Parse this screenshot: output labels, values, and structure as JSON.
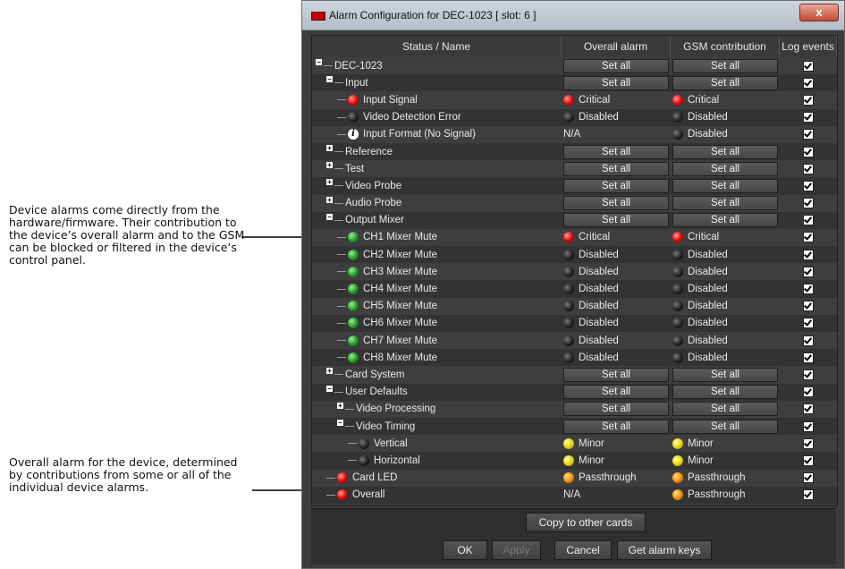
{
  "annotations": {
    "device_alarms": "Device alarms come directly from the hardware/firmware. Their contribution to the device’s overall alarm and to the GSM can be blocked or filtered in the device’s control panel.",
    "overall_alarm": "Overall alarm for the device, determined by contributions from some or all of the individual device alarms."
  },
  "window": {
    "title": "Alarm Configuration for DEC-1023 [ slot: 6 ]",
    "close_label": "x"
  },
  "table": {
    "headers": [
      "Status / Name",
      "Overall alarm",
      "GSM contribution",
      "Log events"
    ],
    "set_all_label": "Set all",
    "rows": [
      {
        "name": "DEC-1023",
        "expander": "−",
        "overall": "Set all",
        "gsm": "Set all"
      },
      {
        "name": "Input",
        "expander": "−",
        "overall": "Set all",
        "gsm": "Set all"
      },
      {
        "name": "Input Signal",
        "led": "red",
        "overall_led": "red",
        "overall": "Critical",
        "gsm_led": "red",
        "gsm": "Critical"
      },
      {
        "name": "Video Detection Error",
        "led": "black",
        "overall_led": "black",
        "overall": "Disabled",
        "gsm_led": "black",
        "gsm": "Disabled"
      },
      {
        "name": "Input Format (No Signal)",
        "led": "info",
        "overall": "N/A",
        "gsm_led": "black",
        "gsm": "Disabled"
      },
      {
        "name": "Reference",
        "expander": "+",
        "overall": "Set all",
        "gsm": "Set all"
      },
      {
        "name": "Test",
        "expander": "+",
        "overall": "Set all",
        "gsm": "Set all"
      },
      {
        "name": "Video Probe",
        "expander": "+",
        "overall": "Set all",
        "gsm": "Set all"
      },
      {
        "name": "Audio Probe",
        "expander": "+",
        "overall": "Set all",
        "gsm": "Set all"
      },
      {
        "name": "Output Mixer",
        "expander": "−",
        "overall": "Set all",
        "gsm": "Set all"
      },
      {
        "name": "CH1 Mixer Mute",
        "led": "green",
        "overall_led": "red",
        "overall": "Critical",
        "gsm_led": "red",
        "gsm": "Critical"
      },
      {
        "name": "CH2 Mixer Mute",
        "led": "green",
        "overall_led": "black",
        "overall": "Disabled",
        "gsm_led": "black",
        "gsm": "Disabled"
      },
      {
        "name": "CH3 Mixer Mute",
        "led": "green",
        "overall_led": "black",
        "overall": "Disabled",
        "gsm_led": "black",
        "gsm": "Disabled"
      },
      {
        "name": "CH4 Mixer Mute",
        "led": "green",
        "overall_led": "black",
        "overall": "Disabled",
        "gsm_led": "black",
        "gsm": "Disabled"
      },
      {
        "name": "CH5 Mixer Mute",
        "led": "green",
        "overall_led": "black",
        "overall": "Disabled",
        "gsm_led": "black",
        "gsm": "Disabled"
      },
      {
        "name": "CH6 Mixer Mute",
        "led": "green",
        "overall_led": "black",
        "overall": "Disabled",
        "gsm_led": "black",
        "gsm": "Disabled"
      },
      {
        "name": "CH7 Mixer Mute",
        "led": "green",
        "overall_led": "black",
        "overall": "Disabled",
        "gsm_led": "black",
        "gsm": "Disabled"
      },
      {
        "name": "CH8 Mixer Mute",
        "led": "green",
        "overall_led": "black",
        "overall": "Disabled",
        "gsm_led": "black",
        "gsm": "Disabled"
      },
      {
        "name": "Card System",
        "expander": "+",
        "overall": "Set all",
        "gsm": "Set all"
      },
      {
        "name": "User Defaults",
        "expander": "−",
        "overall": "Set all",
        "gsm": "Set all"
      },
      {
        "name": "Video Processing",
        "expander": "+",
        "overall": "Set all",
        "gsm": "Set all"
      },
      {
        "name": "Video Timing",
        "expander": "−",
        "overall": "Set all",
        "gsm": "Set all"
      },
      {
        "name": "Vertical",
        "led": "black",
        "overall_led": "yellow",
        "overall": "Minor",
        "gsm_led": "yellow",
        "gsm": "Minor"
      },
      {
        "name": "Horizontal",
        "led": "black",
        "overall_led": "yellow",
        "overall": "Minor",
        "gsm_led": "yellow",
        "gsm": "Minor"
      },
      {
        "name": "Card LED",
        "led": "red",
        "overall_led": "orange",
        "overall": "Passthrough",
        "gsm_led": "orange",
        "gsm": "Passthrough"
      },
      {
        "name": "Overall",
        "led": "red",
        "overall": "N/A",
        "gsm_led": "orange",
        "gsm": "Passthrough"
      }
    ]
  },
  "footer": {
    "copy_label": "Copy to other cards",
    "ok_label": "OK",
    "apply_label": "Apply",
    "cancel_label": "Cancel",
    "keys_label": "Get alarm keys"
  }
}
